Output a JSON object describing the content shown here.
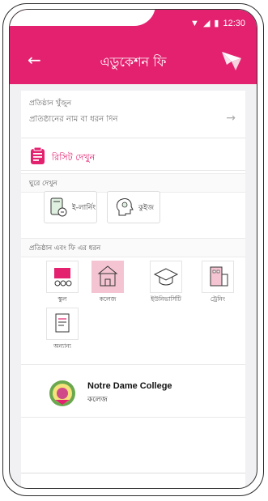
{
  "status": {
    "time": "12:30"
  },
  "appbar": {
    "title": "এডুকেশন ফি"
  },
  "search": {
    "label": "প্রতিষ্ঠান খুঁজুন",
    "placeholder": "প্রতিষ্ঠানের নাম বা ধরন দিন"
  },
  "receipt": {
    "label": "রিসিট দেখুন"
  },
  "explore": {
    "heading": "ঘুরে দেখুন",
    "items": [
      "ই-লার্নিং",
      "কুইজ"
    ]
  },
  "categories": {
    "heading": "প্রতিষ্ঠান এবং ফি এর ধরন",
    "items": [
      "স্কুল",
      "কলেজ",
      "ইউনিভার্সিটি",
      "ট্রেনিং",
      "অন্যান্য"
    ],
    "selected_index": 1
  },
  "institution": {
    "name": "Notre Dame College",
    "type": "কলেজ"
  },
  "colors": {
    "brand": "#e3216f",
    "selected_bg": "#f5c4d3"
  }
}
